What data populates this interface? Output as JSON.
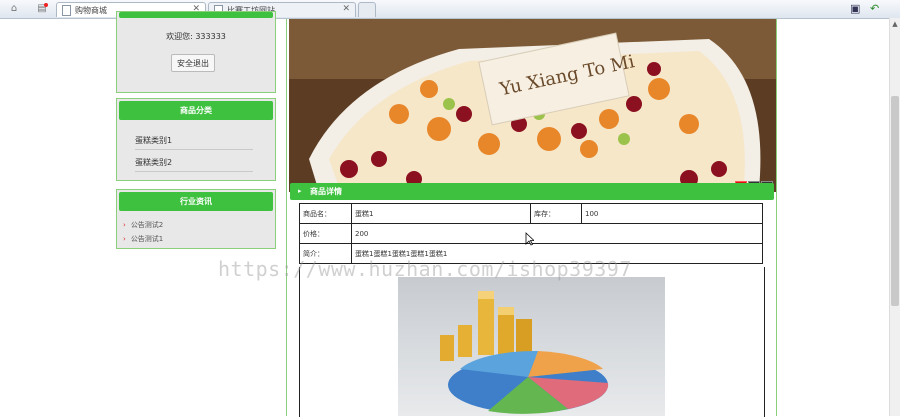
{
  "browser": {
    "tabs": [
      {
        "title": "购物商城",
        "active": true
      },
      {
        "title": "比赛工坊网站",
        "active": false
      }
    ]
  },
  "user_box": {
    "welcome": "欢迎您: 333333",
    "logout": "安全退出"
  },
  "category": {
    "title": "商品分类",
    "items": [
      "蛋糕类别1",
      "蛋糕类别2"
    ]
  },
  "news": {
    "title": "行业资讯",
    "items": [
      "公告测试2",
      "公告测试1"
    ]
  },
  "banner": {
    "cake_text": "Yu Xiang To Mi",
    "dots": [
      "1",
      "2",
      "3"
    ]
  },
  "detail": {
    "title": "商品详情",
    "name_label": "商品名：",
    "name_value": "蛋糕1",
    "stock_label": "库存：",
    "stock_value": "100",
    "price_label": "价格：",
    "price_value": "200",
    "intro_label": "简介：",
    "intro_value": "蛋糕1蛋糕1蛋糕1蛋糕1蛋糕1"
  },
  "watermark": "https://www.huzhan.com/ishop39397",
  "colors": {
    "green": "#3ec13e",
    "border_green": "#8ccf7a",
    "active_dot": "#dd1111"
  }
}
